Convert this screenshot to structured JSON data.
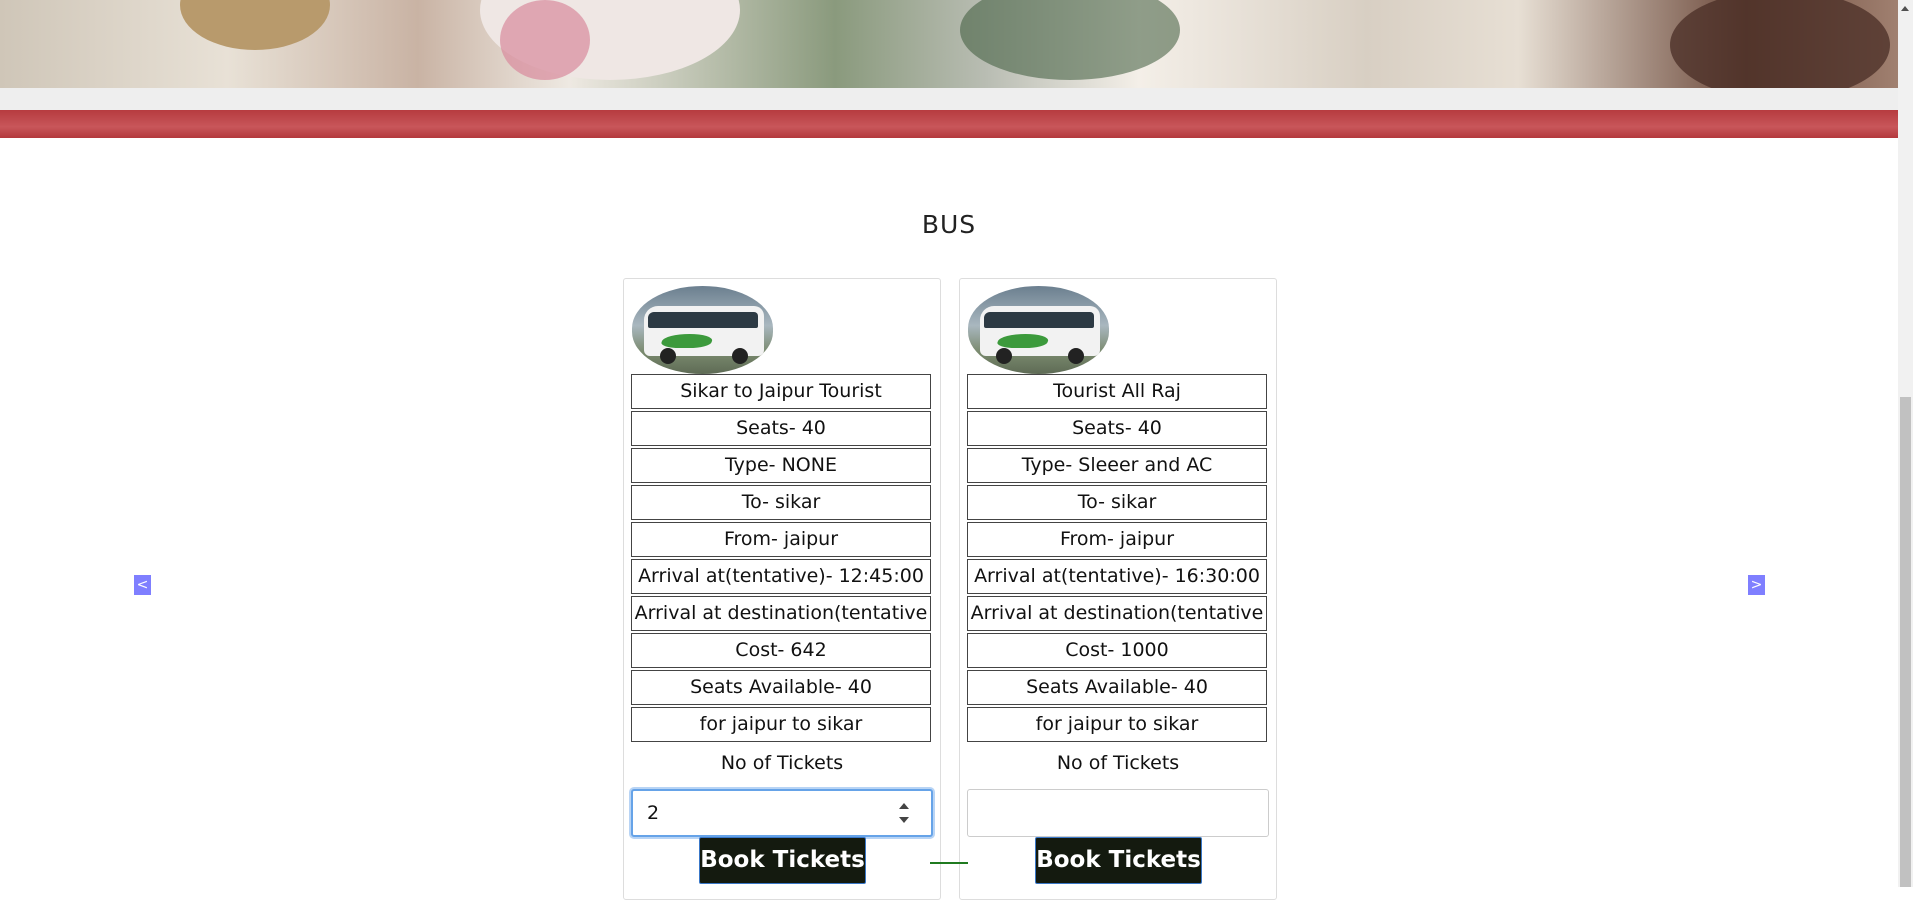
{
  "section": {
    "title": "BUS"
  },
  "nav": {
    "prev_symbol": "<",
    "next_symbol": ">"
  },
  "buses": [
    {
      "name": "Sikar to Jaipur Tourist",
      "seats": "Seats- 40",
      "type": "Type- NONE",
      "to": "To- sikar",
      "from": "From- jaipur",
      "arrival": "Arrival at(tentative)- 12:45:00",
      "arrival_destination": "Arrival at destination(tentative",
      "cost": "Cost- 642",
      "seats_available": "Seats Available- 40",
      "route": "for jaipur to sikar",
      "tickets_label": "No of Tickets",
      "tickets_value": "2",
      "book_label": "Book Tickets"
    },
    {
      "name": "Tourist All Raj",
      "seats": "Seats- 40",
      "type": "Type- Sleeer and AC",
      "to": "To- sikar",
      "from": "From- jaipur",
      "arrival": "Arrival at(tentative)- 16:30:00",
      "arrival_destination": "Arrival at destination(tentative",
      "cost": "Cost- 1000",
      "seats_available": "Seats Available- 40",
      "route": "for jaipur to sikar",
      "tickets_label": "No of Tickets",
      "tickets_value": "",
      "book_label": "Book Tickets"
    }
  ],
  "colors": {
    "band": "#b63b3f",
    "nav_arrow": "#7f7fff",
    "button_bg": "#141a0f",
    "focus_ring": "#66a3e8"
  }
}
